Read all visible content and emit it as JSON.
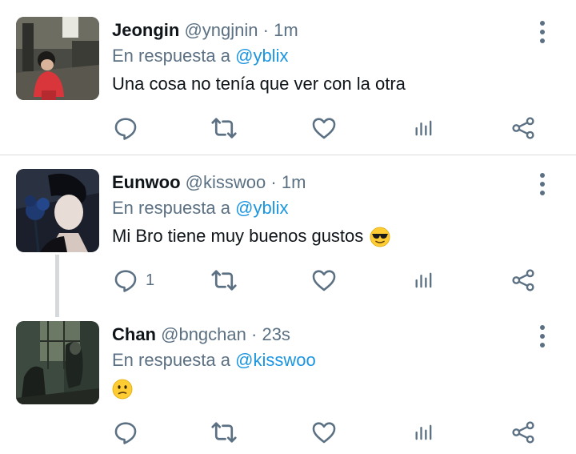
{
  "tweets": [
    {
      "name": "Jeongin",
      "handle": "@yngjnin",
      "separator": "·",
      "time": "1m",
      "reply_prefix": "En respuesta a",
      "reply_to": "@yblix",
      "text": "Una cosa no tenía que ver con la otra",
      "emoji": "",
      "reply_count": "",
      "icons": [
        "reply-icon",
        "retweet-icon",
        "like-icon",
        "analytics-icon",
        "share-icon",
        "more-icon"
      ]
    },
    {
      "name": "Eunwoo",
      "handle": "@kisswoo",
      "separator": "·",
      "time": "1m",
      "reply_prefix": "En respuesta a",
      "reply_to": "@yblix",
      "text": "Mi Bro tiene muy buenos gustos",
      "emoji": "sunglasses-emoji",
      "reply_count": "1",
      "icons": [
        "reply-icon",
        "retweet-icon",
        "like-icon",
        "analytics-icon",
        "share-icon",
        "more-icon"
      ]
    },
    {
      "name": "Chan",
      "handle": "@bngchan",
      "separator": "·",
      "time": "23s",
      "reply_prefix": "En respuesta a",
      "reply_to": "@kisswoo",
      "text": "",
      "emoji": "confused-face-emoji",
      "reply_count": "",
      "icons": [
        "reply-icon",
        "retweet-icon",
        "like-icon",
        "analytics-icon",
        "share-icon",
        "more-icon"
      ]
    }
  ],
  "colors": {
    "name": "#0f1419",
    "secondary": "#5b7083",
    "mention": "#1b95e0",
    "icon": "#5b7083",
    "divider": "#dcdcdc",
    "thread_line": "#d6d9dc"
  }
}
